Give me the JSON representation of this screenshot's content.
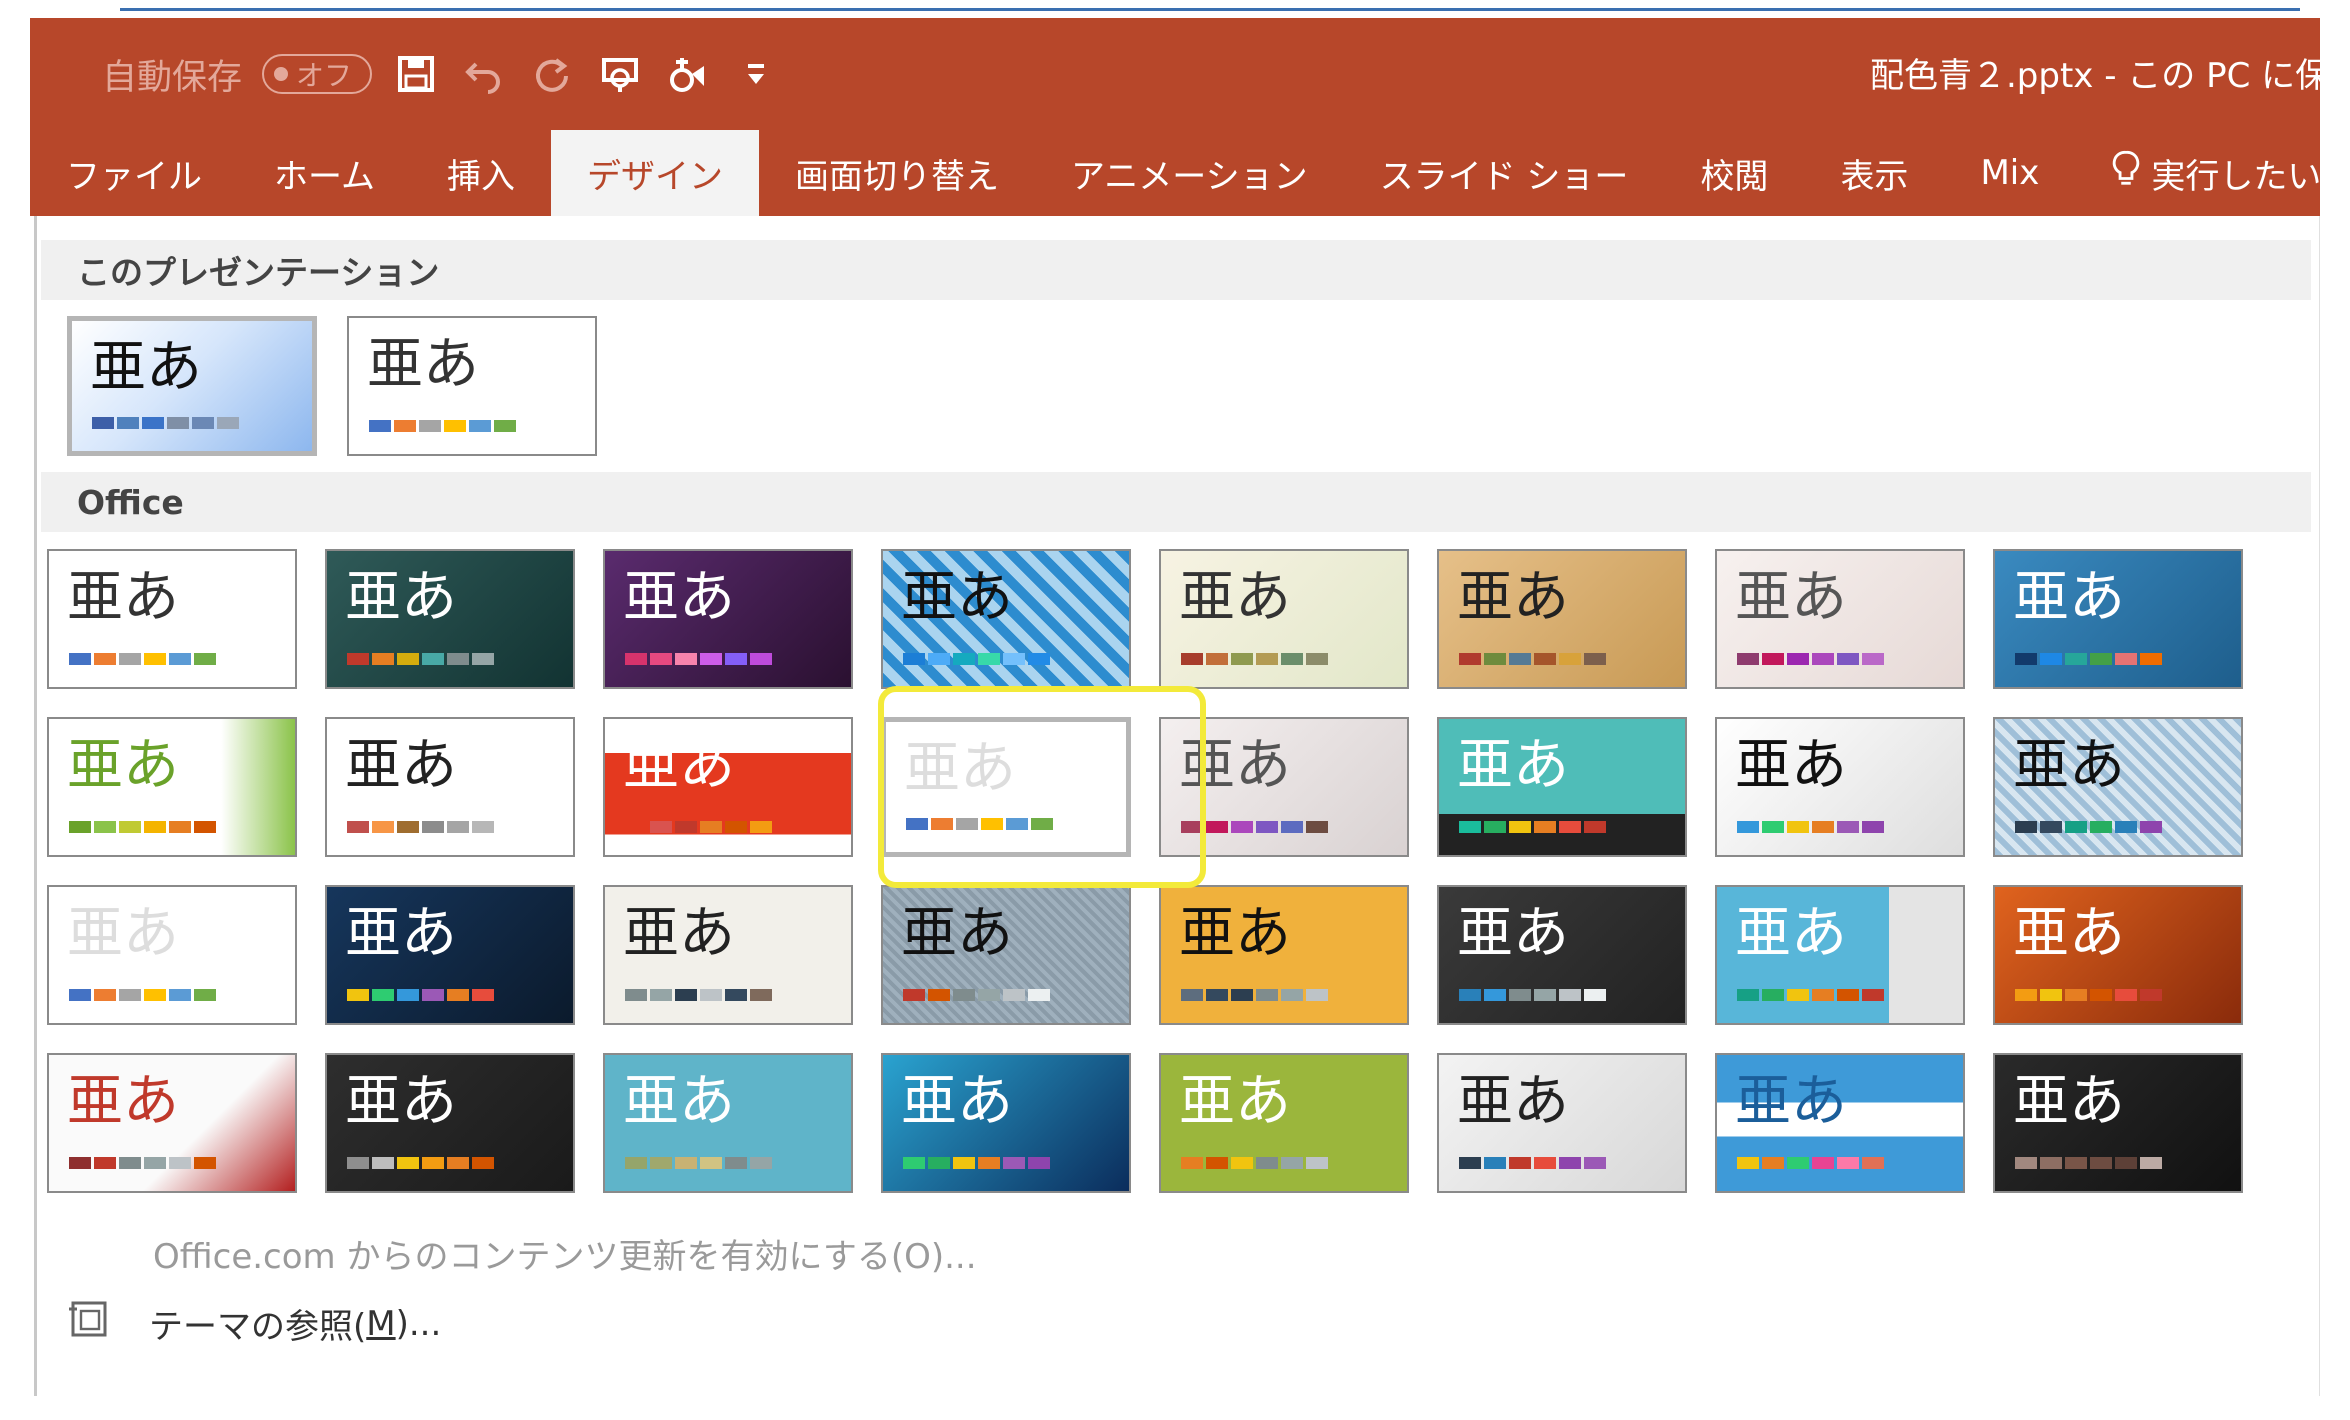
{
  "titlebar": {
    "autosave_label": "自動保存",
    "autosave_toggle": "オフ",
    "document_title": "配色青２.pptx - この PC に保"
  },
  "qat": [
    "save-icon",
    "undo-icon",
    "redo-icon",
    "present-from-start-icon",
    "touch-mode-icon",
    "customize-qat-icon"
  ],
  "tabs": [
    "ファイル",
    "ホーム",
    "挿入",
    "デザイン",
    "画面切り替え",
    "アニメーション",
    "スライド ショー",
    "校閲",
    "表示",
    "Mix",
    "実行したい"
  ],
  "active_tab": "デザイン",
  "gallery": {
    "this_presentation_header": "このプレゼンテーション",
    "office_header": "Office",
    "thumb_text": "亜あ"
  },
  "colors": {
    "accent": "#b7472a",
    "selection_highlight": "#f3ea3a"
  },
  "footer": {
    "enable_updates": "Office.com からのコンテンツ更新を有効にする(O)...",
    "browse_themes_prefix": "テーマの参照(",
    "browse_themes_key": "M",
    "browse_themes_suffix": ")..."
  }
}
